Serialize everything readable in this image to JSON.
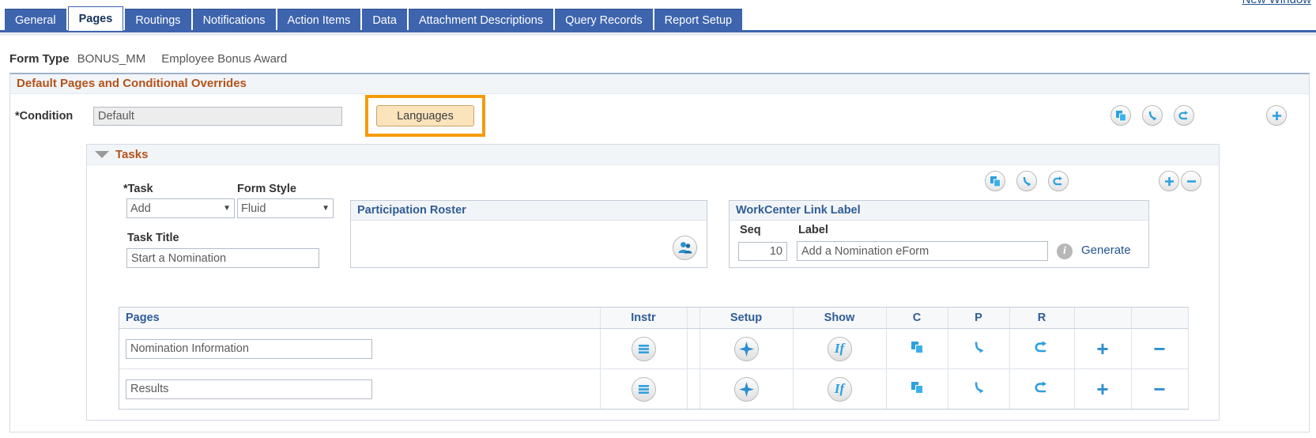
{
  "top_link": {
    "label": "New Window"
  },
  "tabs": [
    {
      "label": "General",
      "active": false
    },
    {
      "label": "Pages",
      "active": true
    },
    {
      "label": "Routings",
      "active": false
    },
    {
      "label": "Notifications",
      "active": false
    },
    {
      "label": "Action Items",
      "active": false
    },
    {
      "label": "Data",
      "active": false
    },
    {
      "label": "Attachment Descriptions",
      "active": false
    },
    {
      "label": "Query Records",
      "active": false
    },
    {
      "label": "Report Setup",
      "active": false
    }
  ],
  "form_type": {
    "label": "Form Type",
    "code": "BONUS_MM",
    "description": "Employee Bonus Award"
  },
  "groupbox": {
    "title": "Default Pages and Conditional Overrides"
  },
  "condition": {
    "label": "*Condition",
    "value": "Default",
    "languages_button": "Languages",
    "actions": [
      {
        "name": "copy-icon",
        "glyph": "❐"
      },
      {
        "name": "personalize-icon",
        "glyph": "⤵"
      },
      {
        "name": "refresh-icon",
        "glyph": "↶"
      }
    ],
    "add_button": "+"
  },
  "tasks": {
    "title": "Tasks",
    "task_label": "*Task",
    "task_value": "Add",
    "form_style_label": "Form Style",
    "form_style_value": "Fluid",
    "task_title_label": "Task Title",
    "task_title_value": "Start a Nomination",
    "add_button": "+",
    "remove_button": "−"
  },
  "participation_roster": {
    "title": "Participation Roster",
    "icon": "roster-person-icon"
  },
  "workcenter": {
    "title": "WorkCenter Link Label",
    "seq_header": "Seq",
    "label_header": "Label",
    "seq_value": "10",
    "label_value": "Add a Nomination eForm",
    "info_icon": "i",
    "generate_link": "Generate"
  },
  "pages_grid": {
    "headers": [
      "Pages",
      "Instr",
      "",
      "Setup",
      "Show",
      "C",
      "P",
      "R",
      "",
      ""
    ],
    "rows": [
      {
        "page_name": "Nomination Information",
        "instr": "instructions-icon",
        "setup": "setup-icon",
        "show": "If",
        "c": "❐",
        "p": "⤵",
        "r": "↶",
        "add": "+",
        "remove": "−"
      },
      {
        "page_name": "Results",
        "instr": "instructions-icon",
        "setup": "setup-icon",
        "show": "If",
        "c": "❐",
        "p": "⤵",
        "r": "↶",
        "add": "+",
        "remove": "−"
      }
    ]
  },
  "colors": {
    "tab_blue": "#3d64ad",
    "section_orange": "#b4521a",
    "highlight_orange": "#f59b0b",
    "link_blue": "#23538f",
    "icon_blue": "#2da0df"
  }
}
